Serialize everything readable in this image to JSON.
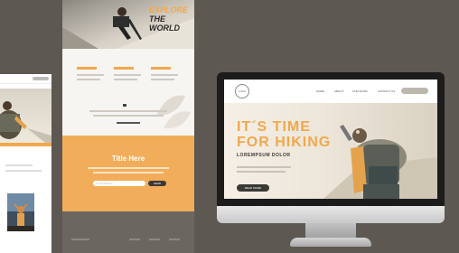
{
  "mid_page": {
    "hero_title_line1": "EXPLORE",
    "hero_title_line2": "THE WORLD",
    "middle_title": "Title Here",
    "input_placeholder": "email address",
    "button_label": "SEND"
  },
  "monitor_site": {
    "logo_text": "LOGO",
    "nav_items": [
      "HOME",
      "ABOUT",
      "OUR WORK",
      "CONTACT US"
    ],
    "headline_line1": "IT´S TIME",
    "headline_line2": "FOR HIKING",
    "subheadline": "LOREMPSUM DOLOR",
    "button_label": "READ MORE"
  },
  "colors": {
    "accent": "#f1a84c",
    "dark": "#3b3935",
    "background": "#5d5851"
  }
}
